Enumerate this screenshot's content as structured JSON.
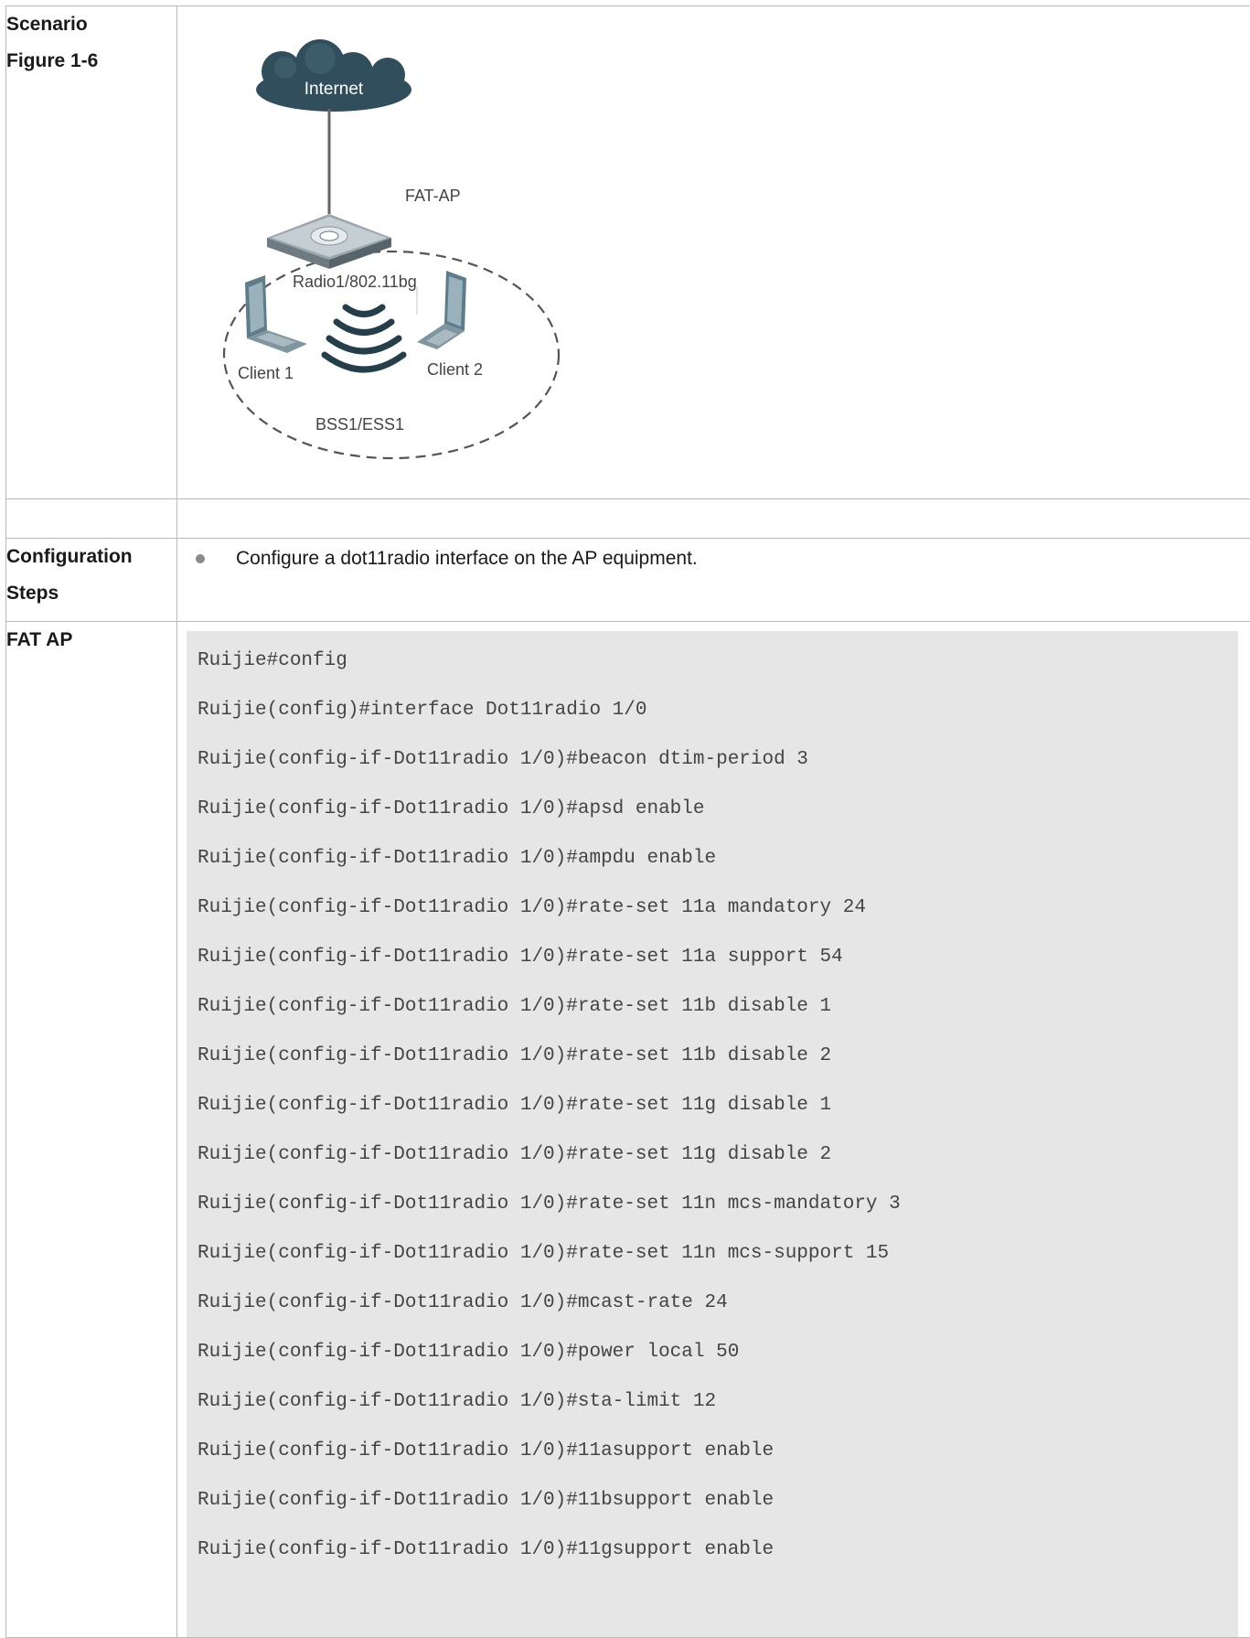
{
  "labels": {
    "scenario": "Scenario",
    "figure": "Figure 1-6",
    "config_steps": "Configuration Steps",
    "fat_ap": "FAT AP"
  },
  "diagram": {
    "internet": "Internet",
    "ap": "FAT-AP",
    "radio": "Radio1/802.11bg",
    "client1": "Client 1",
    "client2": "Client 2",
    "bss": "BSS1/ESS1"
  },
  "steps": [
    "Configure a dot11radio interface on the AP equipment."
  ],
  "code_lines": [
    "Ruijie#config",
    "Ruijie(config)#interface Dot11radio 1/0",
    "Ruijie(config-if-Dot11radio 1/0)#beacon dtim-period 3",
    "Ruijie(config-if-Dot11radio 1/0)#apsd enable",
    "Ruijie(config-if-Dot11radio 1/0)#ampdu enable",
    "Ruijie(config-if-Dot11radio 1/0)#rate-set 11a mandatory 24",
    "Ruijie(config-if-Dot11radio 1/0)#rate-set 11a support 54",
    "Ruijie(config-if-Dot11radio 1/0)#rate-set 11b disable 1",
    "Ruijie(config-if-Dot11radio 1/0)#rate-set 11b disable 2",
    "Ruijie(config-if-Dot11radio 1/0)#rate-set 11g disable 1",
    "Ruijie(config-if-Dot11radio 1/0)#rate-set 11g disable 2",
    "Ruijie(config-if-Dot11radio 1/0)#rate-set 11n mcs-mandatory 3",
    "Ruijie(config-if-Dot11radio 1/0)#rate-set 11n mcs-support 15",
    "Ruijie(config-if-Dot11radio 1/0)#mcast-rate 24",
    "Ruijie(config-if-Dot11radio 1/0)#power local 50",
    "Ruijie(config-if-Dot11radio 1/0)#sta-limit 12",
    "Ruijie(config-if-Dot11radio 1/0)#11asupport enable",
    "Ruijie(config-if-Dot11radio 1/0)#11bsupport enable",
    "Ruijie(config-if-Dot11radio 1/0)#11gsupport enable"
  ]
}
